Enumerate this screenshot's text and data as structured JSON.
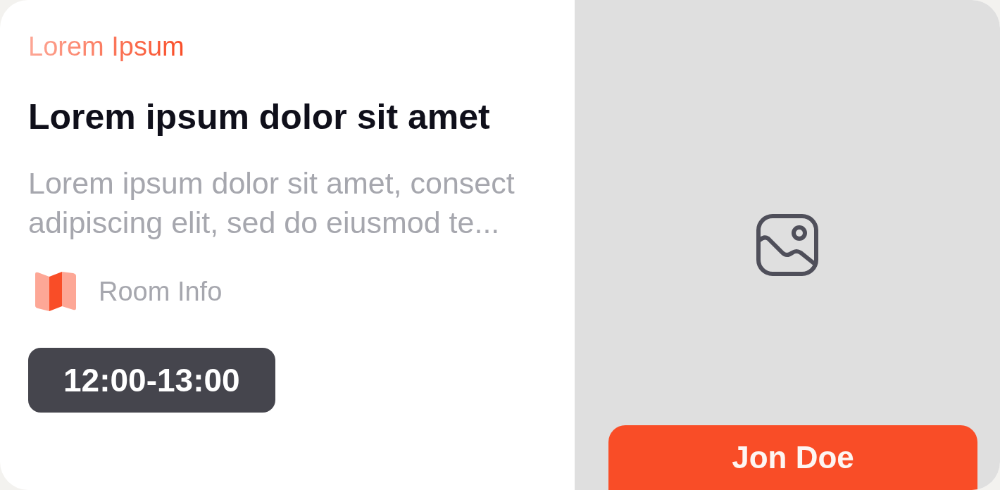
{
  "card": {
    "category": "Lorem Ipsum",
    "title": "Lorem ipsum dolor sit amet",
    "description": "Lorem ipsum dolor sit amet, consect adipiscing elit, sed do eiusmod te...",
    "location": "Room Info",
    "time": "12:00-13:00",
    "image": {
      "kind": "placeholder"
    },
    "host_button": "Jon Doe"
  }
}
